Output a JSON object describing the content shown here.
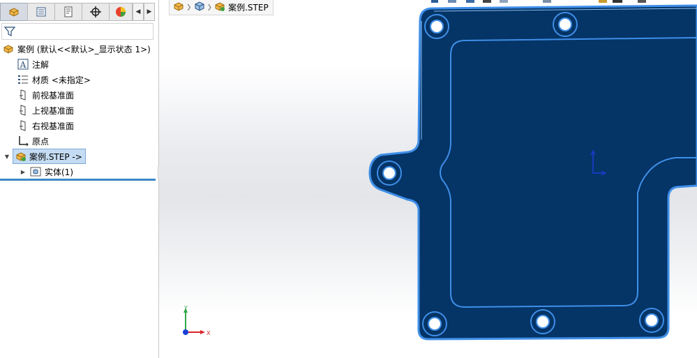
{
  "window": {
    "width": 999,
    "height": 513
  },
  "tree": {
    "root_label": "案例  (默认<<默认>_显示状态 1>)",
    "items": [
      {
        "label": "注解",
        "icon": "annotations-icon"
      },
      {
        "label": "材质 <未指定>",
        "icon": "material-icon"
      },
      {
        "label": "前视基准面",
        "icon": "plane-icon"
      },
      {
        "label": "上视基准面",
        "icon": "plane-icon"
      },
      {
        "label": "右视基准面",
        "icon": "plane-icon"
      },
      {
        "label": "原点",
        "icon": "origin-icon"
      }
    ],
    "imported_part": {
      "label": "案例.STEP ->",
      "icon": "part-icon",
      "expanded": true
    },
    "solid_bodies": {
      "label": "实体(1)",
      "icon": "solid-bodies-folder-icon",
      "expanded": false
    }
  },
  "breadcrumb": {
    "part_label": "案例.STEP"
  },
  "triad": {
    "x_label": "X",
    "y_label": "Y"
  },
  "colors": {
    "model_fill": "#053466",
    "model_edge": "#3f8fe8",
    "selection": "#c4dcf3",
    "rollback_bar": "#3d87c7"
  }
}
